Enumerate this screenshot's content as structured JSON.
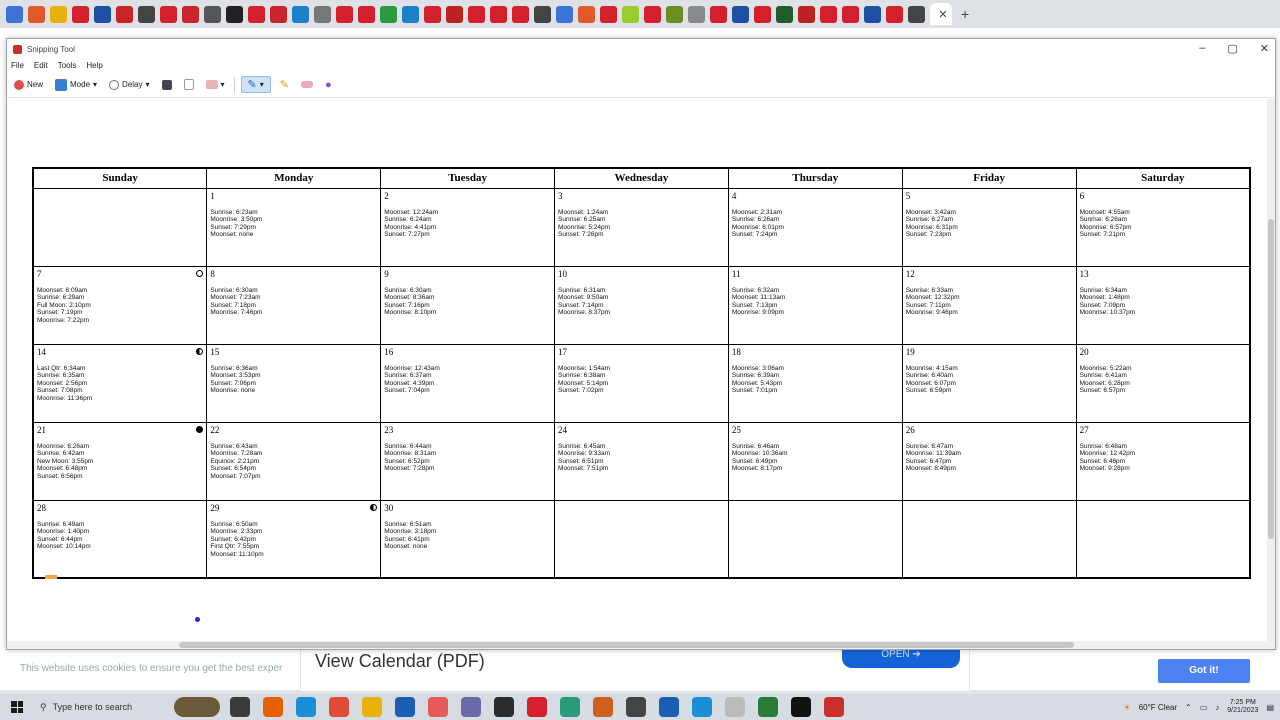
{
  "browser": {
    "tabs": [
      {
        "color": "#3b73d6"
      },
      {
        "color": "#e25a2c"
      },
      {
        "color": "#e8b10a"
      },
      {
        "color": "#d3202c"
      },
      {
        "color": "#1d4fa3"
      },
      {
        "color": "#c9242a"
      },
      {
        "color": "#444444"
      },
      {
        "color": "#d3202c"
      },
      {
        "color": "#c9242a"
      },
      {
        "color": "#555555"
      },
      {
        "color": "#222222"
      },
      {
        "color": "#d3202c"
      },
      {
        "color": "#c9242a"
      },
      {
        "color": "#1e7fc9"
      },
      {
        "color": "#777777"
      },
      {
        "color": "#d3202c"
      },
      {
        "color": "#d3202c"
      },
      {
        "color": "#2a9a3a"
      },
      {
        "color": "#1e7fc9"
      },
      {
        "color": "#d3202c"
      },
      {
        "color": "#b22"
      },
      {
        "color": "#d3202c"
      },
      {
        "color": "#d3202c"
      },
      {
        "color": "#d3202c"
      },
      {
        "color": "#444444"
      },
      {
        "color": "#3b73d6"
      },
      {
        "color": "#e25a2c"
      },
      {
        "color": "#d3202c"
      },
      {
        "color": "#9acd32"
      },
      {
        "color": "#d3202c"
      },
      {
        "color": "#6b8e23"
      },
      {
        "color": "#8a8a8a"
      },
      {
        "color": "#d3202c"
      },
      {
        "color": "#1d4fa3"
      },
      {
        "color": "#d3202c"
      },
      {
        "color": "#1e5c2a"
      },
      {
        "color": "#b22"
      },
      {
        "color": "#d3202c"
      },
      {
        "color": "#d3202c"
      },
      {
        "color": "#1d4fa3"
      },
      {
        "color": "#d3202c"
      },
      {
        "color": "#444444"
      }
    ]
  },
  "snipping_tool": {
    "title": "Snipping Tool",
    "menu": [
      "File",
      "Edit",
      "Tools",
      "Help"
    ],
    "toolbar": {
      "new_label": "New",
      "mode_label": "Mode",
      "delay_label": "Delay"
    }
  },
  "calendar": {
    "weekdays": [
      "Sunday",
      "Monday",
      "Tuesday",
      "Wednesday",
      "Thursday",
      "Friday",
      "Saturday"
    ],
    "weeks": [
      [
        {
          "day": "",
          "lines": []
        },
        {
          "day": "1",
          "lines": [
            "Sunrise: 6:23am",
            "Moonrise: 3:50pm",
            "Sunset: 7:29pm",
            "Moonset: none"
          ]
        },
        {
          "day": "2",
          "lines": [
            "Moonset: 12:24am",
            "Sunrise: 6:24am",
            "Moonrise: 4:41pm",
            "Sunset: 7:27pm"
          ]
        },
        {
          "day": "3",
          "lines": [
            "Moonset: 1:24am",
            "Sunrise: 6:25am",
            "Moonrise: 5:24pm",
            "Sunset: 7:26pm"
          ]
        },
        {
          "day": "4",
          "lines": [
            "Moonset: 2:31am",
            "Sunrise: 6:26am",
            "Moonrise: 6:01pm",
            "Sunset: 7:24pm"
          ]
        },
        {
          "day": "5",
          "lines": [
            "Moonset: 3:42am",
            "Sunrise: 6:27am",
            "Moonrise: 6:31pm",
            "Sunset: 7:23pm"
          ]
        },
        {
          "day": "6",
          "lines": [
            "Moonset: 4:55am",
            "Sunrise: 6:28am",
            "Moonrise: 6:57pm",
            "Sunset: 7:21pm"
          ]
        }
      ],
      [
        {
          "day": "7",
          "phase": "full",
          "lines": [
            "Moonset: 6:09am",
            "Sunrise: 6:29am",
            "Full Moon: 2:10pm",
            "Sunset: 7:19pm",
            "Moonrise: 7:22pm"
          ]
        },
        {
          "day": "8",
          "lines": [
            "Sunrise: 6:30am",
            "Moonset: 7:23am",
            "Sunset: 7:18pm",
            "Moonrise: 7:46pm"
          ]
        },
        {
          "day": "9",
          "lines": [
            "Sunrise: 6:30am",
            "Moonset: 8:36am",
            "Sunset: 7:16pm",
            "Moonrise: 8:10pm"
          ]
        },
        {
          "day": "10",
          "lines": [
            "Sunrise: 6:31am",
            "Moonset: 9:50am",
            "Sunset: 7:14pm",
            "Moonrise: 8:37pm"
          ]
        },
        {
          "day": "11",
          "lines": [
            "Sunrise: 6:32am",
            "Moonset: 11:13am",
            "Sunset: 7:13pm",
            "Moonrise: 9:09pm"
          ]
        },
        {
          "day": "12",
          "lines": [
            "Sunrise: 6:33am",
            "Moonset: 12:32pm",
            "Sunset: 7:11pm",
            "Moonrise: 9:46pm"
          ]
        },
        {
          "day": "13",
          "lines": [
            "Sunrise: 6:34am",
            "Moonset: 1:48pm",
            "Sunset: 7:09pm",
            "Moonrise: 10:37pm"
          ]
        }
      ],
      [
        {
          "day": "14",
          "phase": "half",
          "lines": [
            "Last Qtr: 6:34am",
            "Sunrise: 6:35am",
            "Moonset: 2:56pm",
            "Sunset: 7:08pm",
            "Moonrise: 11:36pm"
          ]
        },
        {
          "day": "15",
          "lines": [
            "Sunrise: 6:36am",
            "Moonset: 3:53pm",
            "Sunset: 7:06pm",
            "Moonrise: none"
          ]
        },
        {
          "day": "16",
          "lines": [
            "Moonrise: 12:43am",
            "Sunrise: 6:37am",
            "Moonset: 4:39pm",
            "Sunset: 7:04pm"
          ]
        },
        {
          "day": "17",
          "lines": [
            "Moonrise: 1:54am",
            "Sunrise: 6:38am",
            "Moonset: 5:14pm",
            "Sunset: 7:02pm"
          ]
        },
        {
          "day": "18",
          "lines": [
            "Moonrise: 3:06am",
            "Sunrise: 6:39am",
            "Moonset: 5:43pm",
            "Sunset: 7:01pm"
          ]
        },
        {
          "day": "19",
          "lines": [
            "Moonrise: 4:15am",
            "Sunrise: 6:40am",
            "Moonset: 6:07pm",
            "Sunset: 6:59pm"
          ]
        },
        {
          "day": "20",
          "lines": [
            "Moonrise: 5:22am",
            "Sunrise: 6:41am",
            "Moonset: 6:28pm",
            "Sunset: 6:57pm"
          ]
        }
      ],
      [
        {
          "day": "21",
          "phase": "new",
          "lines": [
            "Moonrise: 6:26am",
            "Sunrise: 6:42am",
            "New Moon: 3:55pm",
            "Moonset: 6:48pm",
            "Sunset: 6:56pm"
          ]
        },
        {
          "day": "22",
          "lines": [
            "Sunrise: 6:43am",
            "Moonrise: 7:28am",
            "Equinox: 2:21pm",
            "Sunset: 6:54pm",
            "Moonset: 7:07pm"
          ]
        },
        {
          "day": "23",
          "lines": [
            "Sunrise: 6:44am",
            "Moonrise: 8:31am",
            "Sunset: 6:52pm",
            "Moonset: 7:28pm"
          ]
        },
        {
          "day": "24",
          "lines": [
            "Sunrise: 6:45am",
            "Moonrise: 9:33am",
            "Sunset: 6:51pm",
            "Moonset: 7:51pm"
          ]
        },
        {
          "day": "25",
          "lines": [
            "Sunrise: 6:46am",
            "Moonrise: 10:36am",
            "Sunset: 6:49pm",
            "Moonset: 8:17pm"
          ]
        },
        {
          "day": "26",
          "lines": [
            "Sunrise: 6:47am",
            "Moonrise: 11:39am",
            "Sunset: 6:47pm",
            "Moonset: 8:49pm"
          ]
        },
        {
          "day": "27",
          "lines": [
            "Sunrise: 6:48am",
            "Moonrise: 12:42pm",
            "Sunset: 6:46pm",
            "Moonset: 9:28pm"
          ]
        }
      ],
      [
        {
          "day": "28",
          "lines": [
            "Sunrise: 6:49am",
            "Moonrise: 1:40pm",
            "Sunset: 6:44pm",
            "Moonset: 10:14pm"
          ]
        },
        {
          "day": "29",
          "phase": "half",
          "lines": [
            "Sunrise: 6:50am",
            "Moonrise: 2:33pm",
            "Sunset: 6:42pm",
            "First Qtr: 7:55pm",
            "Moonset: 11:10pm"
          ]
        },
        {
          "day": "30",
          "lines": [
            "Sunrise: 6:51am",
            "Moonrise: 3:18pm",
            "Sunset: 6:41pm",
            "Moonset: none"
          ]
        },
        {
          "day": "",
          "lines": []
        },
        {
          "day": "",
          "lines": []
        },
        {
          "day": "",
          "lines": []
        },
        {
          "day": "",
          "lines": []
        }
      ]
    ]
  },
  "webpage": {
    "cookie_notice": "This website uses cookies to ensure you get the best exper",
    "view_calendar_label": "View Calendar (PDF)",
    "open_label": "OPEN ➔",
    "got_it_label": "Got it!"
  },
  "taskbar": {
    "search_placeholder": "Type here to search",
    "apps": [
      {
        "name": "task-view",
        "color": "#3a3a3a"
      },
      {
        "name": "firefox",
        "color": "#e66000"
      },
      {
        "name": "edge",
        "color": "#1a8fd8"
      },
      {
        "name": "chrome",
        "color": "#dd4b39"
      },
      {
        "name": "file-explorer",
        "color": "#e8b10a"
      },
      {
        "name": "mail",
        "color": "#1a5fb4"
      },
      {
        "name": "app-7",
        "color": "#e65a5a"
      },
      {
        "name": "app-8",
        "color": "#6a6aa8"
      },
      {
        "name": "app-9",
        "color": "#2b2b2b"
      },
      {
        "name": "opera",
        "color": "#d3202c"
      },
      {
        "name": "app-11",
        "color": "#2a9a7a"
      },
      {
        "name": "app-12",
        "color": "#d06020"
      },
      {
        "name": "app-13",
        "color": "#444444"
      },
      {
        "name": "app-14",
        "color": "#1a5fb4"
      },
      {
        "name": "app-15",
        "color": "#1a8fd8"
      },
      {
        "name": "app-16",
        "color": "#bbbbbb"
      },
      {
        "name": "app-17",
        "color": "#2a7a3a"
      },
      {
        "name": "app-18",
        "color": "#111111"
      },
      {
        "name": "snipping-tool",
        "color": "#c8302c"
      }
    ],
    "weather": "60°F Clear",
    "time": "7:25 PM",
    "date": "9/21/2023"
  }
}
